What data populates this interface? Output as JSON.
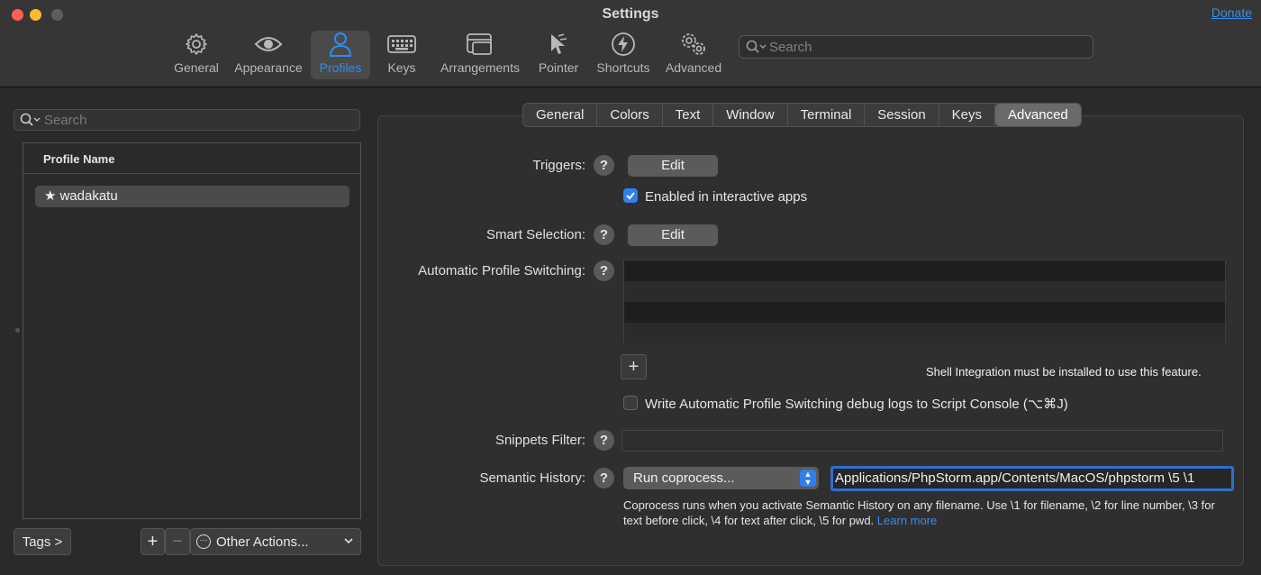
{
  "window": {
    "title": "Settings",
    "donate_label": "Donate"
  },
  "toolbar": {
    "items": [
      {
        "label": "General",
        "icon": "gear-icon"
      },
      {
        "label": "Appearance",
        "icon": "eye-icon"
      },
      {
        "label": "Profiles",
        "icon": "person-icon"
      },
      {
        "label": "Keys",
        "icon": "keyboard-icon"
      },
      {
        "label": "Arrangements",
        "icon": "windows-icon"
      },
      {
        "label": "Pointer",
        "icon": "pointer-icon"
      },
      {
        "label": "Shortcuts",
        "icon": "lightning-icon"
      },
      {
        "label": "Advanced",
        "icon": "gears-icon"
      }
    ],
    "active": "Profiles",
    "search_placeholder": "Search"
  },
  "profiles": {
    "search_placeholder": "Search",
    "column_header": "Profile Name",
    "rows": [
      {
        "name": "wadakatu",
        "default": true
      }
    ],
    "tags_label": "Tags >",
    "add_label": "+",
    "remove_label": "−",
    "other_actions_label": "Other Actions..."
  },
  "tabs": {
    "items": [
      "General",
      "Colors",
      "Text",
      "Window",
      "Terminal",
      "Session",
      "Keys",
      "Advanced"
    ],
    "selected": "Advanced"
  },
  "advanced": {
    "triggers": {
      "label": "Triggers:",
      "edit_label": "Edit",
      "enabled_label": "Enabled in interactive apps",
      "enabled": true
    },
    "smart_selection": {
      "label": "Smart Selection:",
      "edit_label": "Edit"
    },
    "auto_profile_switching": {
      "label": "Automatic Profile Switching:",
      "add_label": "+",
      "note": "Shell Integration must be installed to use this feature.",
      "debug_label": "Write Automatic Profile Switching debug logs to Script Console (⌥⌘J)",
      "debug_enabled": false
    },
    "snippets_filter": {
      "label": "Snippets Filter:",
      "value": ""
    },
    "semantic_history": {
      "label": "Semantic History:",
      "action": "Run coprocess...",
      "command": "Applications/PhpStorm.app/Contents/MacOS/phpstorm \\5 \\1",
      "help_text": "Coprocess runs when you activate Semantic History on any filename. Use \\1 for filename, \\2 for line number, \\3 for text before click, \\4 for text after click, \\5 for pwd.",
      "learn_more": "Learn more"
    },
    "help_glyph": "?"
  },
  "colors": {
    "accent": "#2f7ff1",
    "link": "#3a8ee6",
    "background": "#2a2a2a"
  }
}
